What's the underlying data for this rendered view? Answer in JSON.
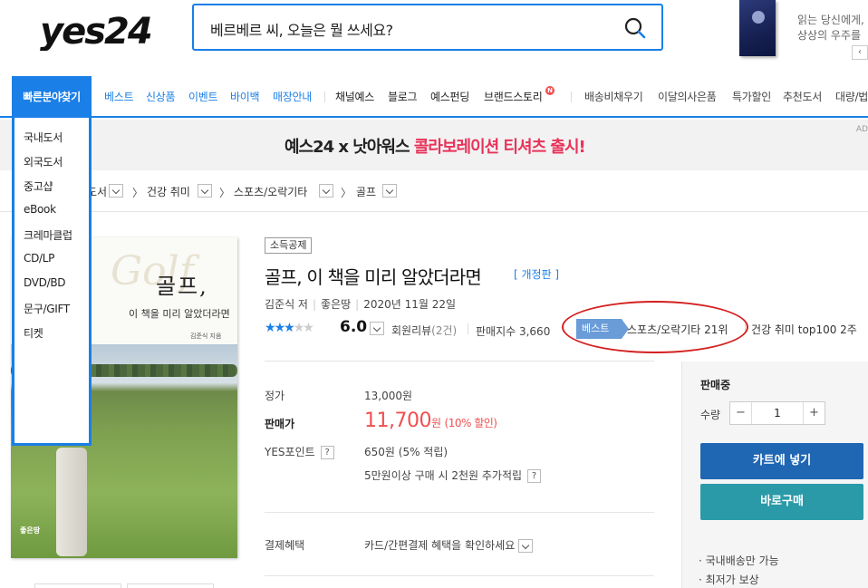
{
  "header": {
    "logo_text": "yes24",
    "search_placeholder": "베르베르 씨, 오늘은 뭘 쓰세요?",
    "promo_line1": "읽는 당신에게,",
    "promo_line2": "상상의 우주를",
    "promo_prev": "‹"
  },
  "nav": {
    "quick": "빠른분야찾기",
    "items_blue": [
      "베스트",
      "신상품",
      "이벤트",
      "바이백",
      "매장안내"
    ],
    "items_dark": [
      "채널예스",
      "블로그",
      "예스펀딩",
      "브랜드스토리"
    ],
    "new_badge": "N",
    "items_gray": [
      "배송비채우기",
      "이달의사은품",
      "특가할인",
      "추천도서",
      "대량/법"
    ]
  },
  "quick_menu": [
    "국내도서",
    "외국도서",
    "중고샵",
    "eBook",
    "크레마클럽",
    "CD/LP",
    "DVD/BD",
    "문구/GIFT",
    "티켓"
  ],
  "banner": {
    "text_plain": "예스24 x 낫아워스 ",
    "text_highlight": "콜라보레이션 티셔츠 출시!",
    "ad": "AD"
  },
  "breadcrumb": [
    "도서",
    "건강 취미",
    "스포츠/오락기타",
    "골프"
  ],
  "cover": {
    "title": "골프,",
    "subtitle": "이 책을 미리 알았더라면",
    "author": "김준식 지음",
    "publisher": "좋은땅",
    "script": "Golf"
  },
  "product": {
    "tag": "소득공제",
    "title": "골프, 이 책을 미리 알았더라면",
    "edition": "[ 개정판 ]",
    "author": "김준식 저",
    "publisher": "좋은땅",
    "date": "2020년 11월 22일",
    "stars_on": 3,
    "rating": "6.0",
    "review_label": "회원리뷰",
    "review_count": "(2건)",
    "sales_index": "판매지수 3,660",
    "best_badge": "베스트",
    "best_rank": "스포츠/오락기타 21위",
    "best_rank2": "건강 취미 top100 2주"
  },
  "price": {
    "list_label": "정가",
    "list_value": "13,000원",
    "sale_label": "판매가",
    "sale_value": "11,700",
    "sale_unit": "원",
    "sale_discount": "(10% 할인)",
    "point_label": "YES포인트",
    "point_value": "650원 (5% 적립)",
    "point_extra": "5만원이상 구매 시 2천원 추가적립",
    "benefit_label": "결제혜택",
    "benefit_value": "카드/간편결제 혜택을 확인하세요",
    "help": "?"
  },
  "panel": {
    "status": "판매중",
    "qty_label": "수량",
    "qty_value": "1",
    "minus": "−",
    "plus": "+",
    "cart": "카트에 넣기",
    "buy": "바로구매",
    "note1": "· 국내배송만 가능",
    "note2": "· 최저가 보상"
  },
  "colors": {
    "accent": "#1a7fe6",
    "sale": "#f05050",
    "cart": "#1f66b3",
    "buy": "#2a9aa8",
    "highlight_ring": "#d42020"
  }
}
